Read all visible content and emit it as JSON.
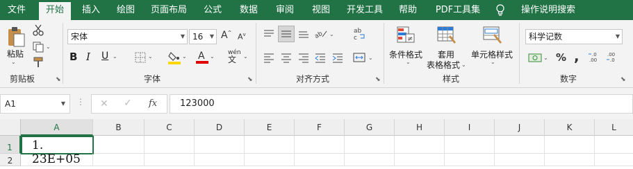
{
  "tabs": [
    "文件",
    "开始",
    "插入",
    "绘图",
    "页面布局",
    "公式",
    "数据",
    "审阅",
    "视图",
    "开发工具",
    "帮助",
    "PDF工具集",
    "操作说明搜索"
  ],
  "active_tab": "开始",
  "clipboard": {
    "paste_label": "粘贴",
    "group_label": "剪贴板"
  },
  "font": {
    "name": "宋体",
    "size": "16",
    "group_label": "字体"
  },
  "alignment": {
    "group_label": "对齐方式"
  },
  "styles": {
    "conditional_format": "条件格式",
    "table_format_line1": "套用",
    "table_format_line2": "表格格式",
    "cell_styles": "单元格样式",
    "group_label": "样式"
  },
  "number": {
    "format": "科学记数",
    "group_label": "数字",
    "percent": "%",
    "comma": ","
  },
  "formula_bar": {
    "name_box": "A1",
    "value": "123000"
  },
  "columns": [
    "A",
    "B",
    "C",
    "D",
    "E",
    "F",
    "G",
    "H",
    "I",
    "J",
    "K",
    "L"
  ],
  "rows": [
    "1",
    "2"
  ],
  "cells": {
    "A1": "1. 23E+05"
  },
  "colors": {
    "accent": "#217346",
    "font_color_bar": "#e00000",
    "fill_color_bar": "#ffd700"
  }
}
